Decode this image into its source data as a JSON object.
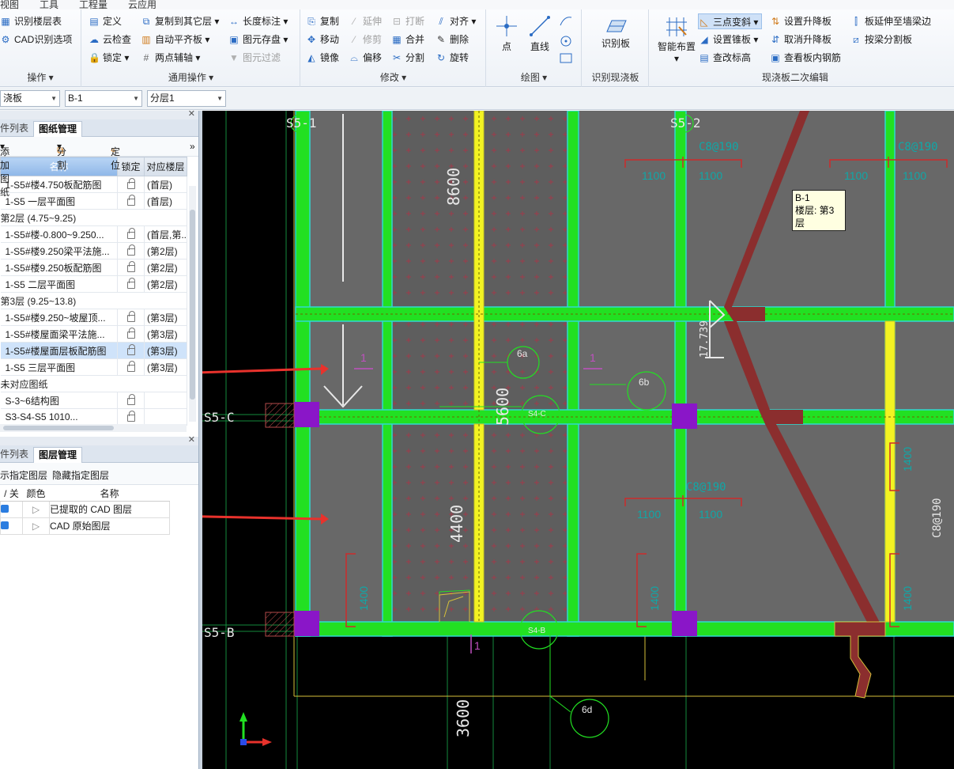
{
  "menu": [
    "视图",
    "工具",
    "工程量",
    "云应用"
  ],
  "ribbon": {
    "groups": [
      {
        "title": "操作",
        "items": [
          "识别楼层表",
          "CAD识别选项"
        ]
      },
      {
        "title": "通用操作",
        "items": [
          "定义",
          "云检查",
          "锁定",
          "复制到其它层",
          "自动平齐板",
          "两点辅轴",
          "长度标注",
          "图元存盘",
          "图元过滤"
        ]
      },
      {
        "title": "修改",
        "items": [
          "复制",
          "移动",
          "镜像",
          "延伸",
          "修剪",
          "偏移",
          "打断",
          "合并",
          "分割",
          "对齐",
          "删除",
          "旋转"
        ]
      },
      {
        "title": "绘图",
        "items": [
          "点",
          "直线"
        ]
      },
      {
        "title": "识别现浇板",
        "items": [
          "识别板"
        ]
      },
      {
        "title": "现浇板二次编辑",
        "items": [
          "智能布置",
          "三点变斜",
          "设置锥板",
          "查改标高",
          "设置升降板",
          "取消升降板",
          "查看板内钢筋",
          "板延伸至墙梁边",
          "按梁分割板"
        ]
      }
    ]
  },
  "toolbar2": {
    "combo1": "浇板",
    "combo2": "B-1",
    "combo3": "分层1"
  },
  "drawing_panel": {
    "tabs": [
      "件列表",
      "图纸管理"
    ],
    "tools": [
      "添加图纸",
      "分割",
      "定位"
    ],
    "columns": [
      "名称",
      "锁定",
      "对应楼层"
    ],
    "rows": [
      {
        "name": "1-S5#楼4.750板配筋图",
        "floor": "(首层)",
        "type": "item"
      },
      {
        "name": "1-S5 一层平面图",
        "floor": "(首层)",
        "type": "item"
      },
      {
        "name": "第2层 (4.75~9.25)",
        "floor": "",
        "type": "group"
      },
      {
        "name": "1-S5#楼-0.800~9.250...",
        "floor": "(首层,第...",
        "type": "item"
      },
      {
        "name": "1-S5#楼9.250梁平法施...",
        "floor": "(第2层)",
        "type": "item"
      },
      {
        "name": "1-S5#楼9.250板配筋图",
        "floor": "(第2层)",
        "type": "item"
      },
      {
        "name": "1-S5 二层平面图",
        "floor": "(第2层)",
        "type": "item"
      },
      {
        "name": "第3层 (9.25~13.8)",
        "floor": "",
        "type": "group"
      },
      {
        "name": "1-S5#楼9.250~坡屋顶...",
        "floor": "(第3层)",
        "type": "item"
      },
      {
        "name": "1-S5#楼屋面梁平法施...",
        "floor": "(第3层)",
        "type": "item"
      },
      {
        "name": "1-S5#楼屋面层板配筋图",
        "floor": "(第3层)",
        "type": "selected"
      },
      {
        "name": "1-S5 三层平面图",
        "floor": "(第3层)",
        "type": "item"
      },
      {
        "name": "未对应图纸",
        "floor": "",
        "type": "group"
      },
      {
        "name": "S-3~6结构图",
        "floor": "",
        "type": "item"
      },
      {
        "name": "S3-S4-S5 1010...",
        "floor": "",
        "type": "item"
      }
    ]
  },
  "layer_panel": {
    "tabs": [
      "件列表",
      "图层管理"
    ],
    "tools": [
      "示指定图层",
      "隐藏指定图层"
    ],
    "columns": [
      "/ 关",
      "颜色",
      "名称"
    ],
    "rows": [
      {
        "name": "已提取的 CAD 图层"
      },
      {
        "name": "CAD 原始图层"
      }
    ]
  },
  "canvas": {
    "axis_labels": [
      "S5-1",
      "S5-2",
      "S5-C",
      "S5-B"
    ],
    "dimensions": [
      "8600",
      "5600",
      "4400",
      "3600",
      "17.739"
    ],
    "rebar_labels": [
      "C8@190",
      "C8@190",
      "C8@190",
      "C8@190",
      "1100",
      "1100",
      "1100",
      "1100",
      "1100",
      "1100",
      "1400",
      "1400",
      "1400",
      "1400"
    ],
    "section_marks": [
      "1",
      "1",
      "1"
    ],
    "bubbles": [
      "6a",
      "6b",
      "6d"
    ],
    "beam_labels": [
      "S4-C",
      "S4-B"
    ],
    "tooltip": {
      "name": "B-1",
      "floor": "楼层: 第3层"
    },
    "colors": {
      "slab": "#686868",
      "beam": "#22e022",
      "beam_edge": "#30d9d0",
      "column": "#8a16c8",
      "slope_line": "#8b2e2e",
      "highlight_beam": "#f3f322",
      "annotation": "#0fa8a8",
      "rebar_red": "#cc2a2a"
    }
  }
}
